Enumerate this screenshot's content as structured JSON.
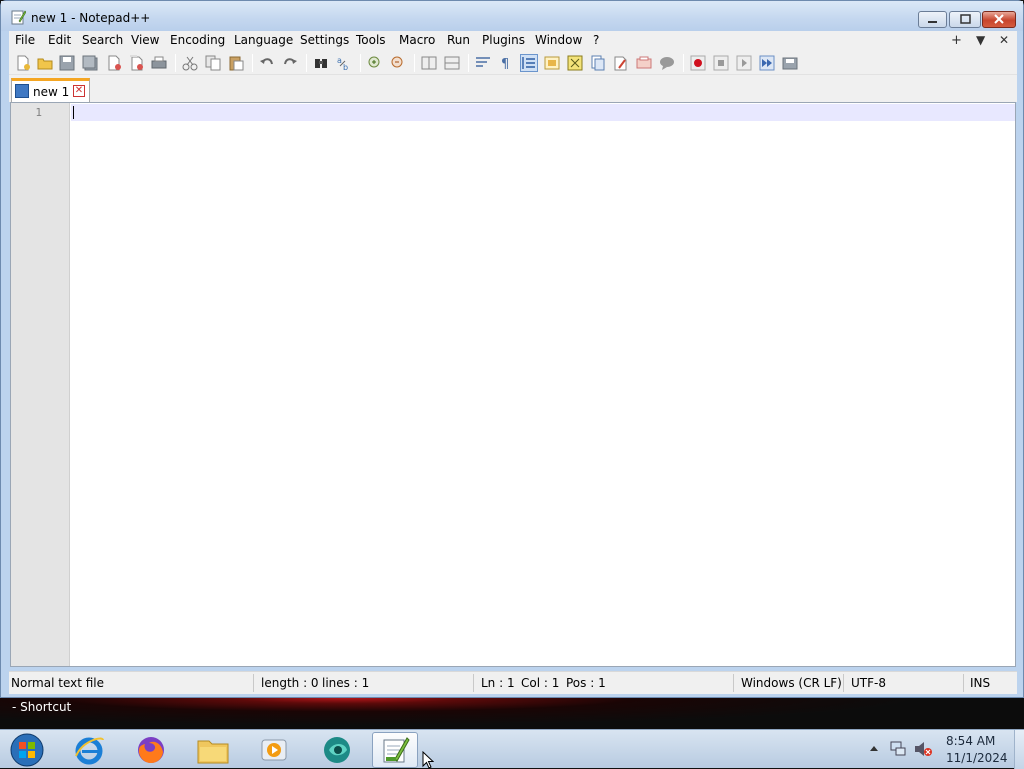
{
  "window": {
    "title": "new 1 - Notepad++",
    "icon": "notepad-plus-plus-icon",
    "controls": [
      "minimize-icon",
      "maximize-icon",
      "close-icon"
    ]
  },
  "menubar": {
    "items": [
      "File",
      "Edit",
      "Search",
      "View",
      "Encoding",
      "Language",
      "Settings",
      "Tools",
      "Macro",
      "Run",
      "Plugins",
      "Window",
      "?"
    ],
    "right": [
      "+",
      "▼",
      "✕"
    ]
  },
  "toolbar": {
    "groups": [
      [
        "new-file-icon",
        "open-file-icon",
        "save-icon",
        "save-all-icon",
        "close-icon",
        "close-all-icon",
        "print-icon"
      ],
      [
        "cut-icon",
        "copy-icon",
        "paste-icon"
      ],
      [
        "undo-icon",
        "redo-icon"
      ],
      [
        "find-icon",
        "replace-icon"
      ],
      [
        "zoom-in-icon",
        "zoom-out-icon"
      ],
      [
        "sync-vertical-icon",
        "sync-horizontal-icon"
      ],
      [
        "word-wrap-icon",
        "show-all-chars-icon",
        "indent-guide-icon",
        "user-language-icon",
        "doc-map-icon",
        "function-list-icon",
        "folder-workspace-icon",
        "monitoring-icon",
        "comment-icon"
      ],
      [
        "record-macro-icon",
        "stop-macro-icon",
        "play-macro-icon",
        "run-macro-multiple-icon",
        "save-macro-icon"
      ]
    ]
  },
  "tabs": [
    {
      "label": "new 1",
      "icon": "saved-disk-icon",
      "close": "✕"
    }
  ],
  "editor": {
    "line_numbers": [
      "1"
    ],
    "content": ""
  },
  "statusbar": {
    "file_type": "Normal text file",
    "length": "length : 0",
    "lines": "lines : 1",
    "ln": "Ln : 1",
    "col": "Col : 1",
    "pos": "Pos : 1",
    "eol": "Windows (CR LF)",
    "encoding": "UTF-8",
    "mode": "INS"
  },
  "desktop": {
    "tooltip": "- Shortcut"
  },
  "taskbar": {
    "pinned": [
      "start-orb-icon",
      "internet-explorer-icon",
      "firefox-icon",
      "file-explorer-icon",
      "media-player-icon",
      "app-icon",
      "notepad-plus-plus-icon"
    ],
    "tray_icons": [
      "show-hidden-icons-icon",
      "network-icon",
      "volume-muted-icon"
    ],
    "time": "8:54 AM",
    "date": "11/1/2024"
  }
}
